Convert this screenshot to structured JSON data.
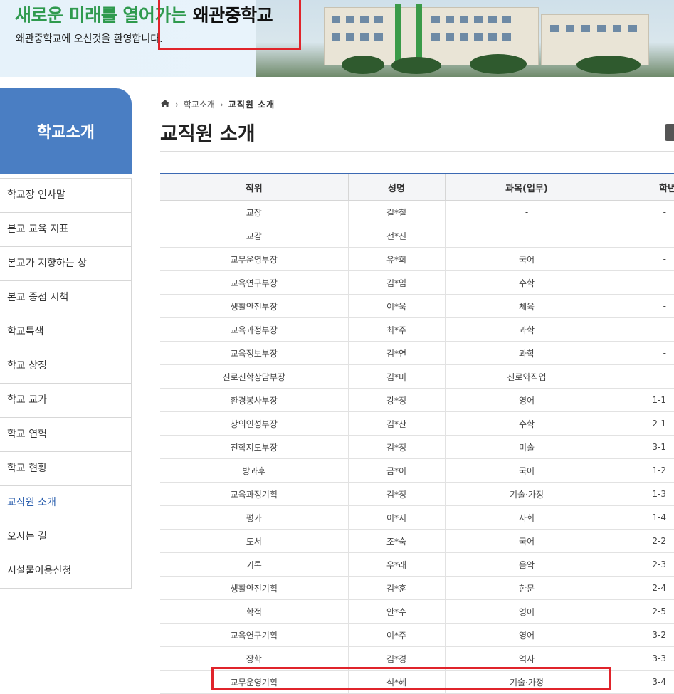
{
  "banner": {
    "title_green": "새로운 미래를 열어가는 ",
    "title_school": "왜관중학교",
    "subtitle": "왜관중학교에 오신것을 환영합니다."
  },
  "sidebar": {
    "heading": "학교소개",
    "items": [
      {
        "label": "학교장 인사말"
      },
      {
        "label": "본교 교육 지표"
      },
      {
        "label": "본교가 지향하는 상"
      },
      {
        "label": "본교 중점 시책"
      },
      {
        "label": "학교특색"
      },
      {
        "label": "학교 상징"
      },
      {
        "label": "학교 교가"
      },
      {
        "label": "학교 연혁"
      },
      {
        "label": "학교 현황"
      },
      {
        "label": "교직원 소개",
        "active": true
      },
      {
        "label": "오시는 길"
      },
      {
        "label": "시설물이용신청"
      }
    ]
  },
  "breadcrumb": {
    "parent": "학교소개",
    "current": "교직원 소개"
  },
  "page": {
    "title": "교직원 소개"
  },
  "table": {
    "headers": [
      "직위",
      "성명",
      "과목(업무)",
      "학년"
    ],
    "rows": [
      [
        "교장",
        "길*철",
        "-",
        "-"
      ],
      [
        "교감",
        "전*진",
        "-",
        "-"
      ],
      [
        "교무운영부장",
        "유*희",
        "국어",
        "-"
      ],
      [
        "교육연구부장",
        "김*임",
        "수학",
        "-"
      ],
      [
        "생활안전부장",
        "이*욱",
        "체육",
        "-"
      ],
      [
        "교육과정부장",
        "최*주",
        "과학",
        "-"
      ],
      [
        "교육정보부장",
        "김*연",
        "과학",
        "-"
      ],
      [
        "진로진학상담부장",
        "김*미",
        "진로와직업",
        "-"
      ],
      [
        "환경봉사부장",
        "강*정",
        "영어",
        "1-1"
      ],
      [
        "창의인성부장",
        "김*산",
        "수학",
        "2-1"
      ],
      [
        "진학지도부장",
        "김*정",
        "미술",
        "3-1"
      ],
      [
        "방과후",
        "금*이",
        "국어",
        "1-2"
      ],
      [
        "교육과정기획",
        "김*정",
        "기술·가정",
        "1-3"
      ],
      [
        "평가",
        "이*지",
        "사회",
        "1-4"
      ],
      [
        "도서",
        "조*숙",
        "국어",
        "2-2"
      ],
      [
        "기록",
        "우*래",
        "음악",
        "2-3"
      ],
      [
        "생활안전기획",
        "김*훈",
        "한문",
        "2-4"
      ],
      [
        "학적",
        "안*수",
        "영어",
        "2-5"
      ],
      [
        "교육연구기획",
        "이*주",
        "영어",
        "3-2"
      ],
      [
        "장학",
        "김*경",
        "역사",
        "3-3"
      ],
      [
        "교무운영기획",
        "석*혜",
        "기술·가정",
        "3-4"
      ]
    ]
  },
  "colors": {
    "brand_green": "#2f9a4e",
    "sidebar_blue": "#4a7ec3",
    "table_top_border": "#3b69b3",
    "highlight_red": "#e0242b"
  },
  "icons": [
    "home-icon",
    "chevron-right-icon",
    "print-icon"
  ]
}
